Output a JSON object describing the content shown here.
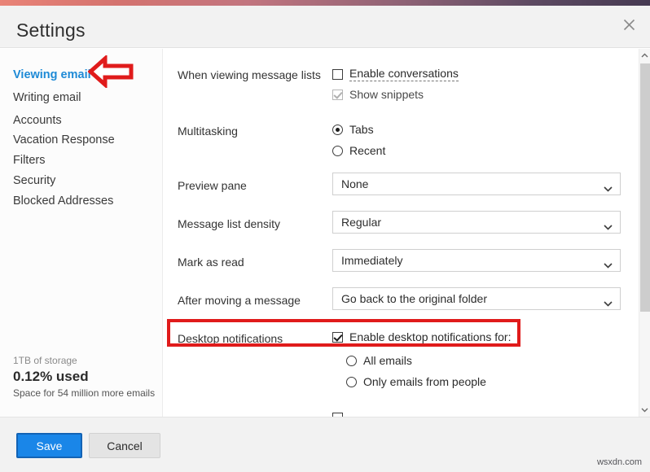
{
  "window": {
    "title": "Settings",
    "close_icon": "close-icon",
    "accent_gradient_start": "#e98377",
    "accent_gradient_end": "#463a52"
  },
  "sidebar": {
    "items": [
      {
        "label": "Viewing email",
        "active": true
      },
      {
        "label": "Writing email",
        "active": false
      },
      {
        "label": "Accounts",
        "active": false
      },
      {
        "label": "Vacation Response",
        "active": false
      },
      {
        "label": "Filters",
        "active": false
      },
      {
        "label": "Security",
        "active": false
      },
      {
        "label": "Blocked Addresses",
        "active": false
      }
    ],
    "active_color": "#1e8ad6",
    "storage": {
      "total": "1TB of storage",
      "used": "0.12% used",
      "note": "Space for 54 million more emails"
    }
  },
  "settings": {
    "rows": [
      {
        "label": "When viewing message lists",
        "options": [
          {
            "type": "checkbox",
            "label": "Enable conversations",
            "checked": false,
            "dotted": true,
            "disabled": false
          },
          {
            "type": "checkbox",
            "label": "Show snippets",
            "checked": true,
            "dotted": false,
            "disabled": true
          }
        ]
      },
      {
        "label": "Multitasking",
        "options": [
          {
            "type": "radio",
            "label": "Tabs",
            "selected": true
          },
          {
            "type": "radio",
            "label": "Recent",
            "selected": false
          }
        ]
      },
      {
        "label": "Preview pane",
        "select_value": "None"
      },
      {
        "label": "Message list density",
        "select_value": "Regular"
      },
      {
        "label": "Mark as read",
        "select_value": "Immediately"
      },
      {
        "label": "After moving a message",
        "select_value": "Go back to the original folder"
      },
      {
        "label": "Desktop notifications",
        "options": [
          {
            "type": "checkbox",
            "label": "Enable desktop notifications for:",
            "checked": true,
            "dotted": false,
            "disabled": false
          },
          {
            "type": "radio",
            "label": "All emails",
            "selected": false
          },
          {
            "type": "radio",
            "label": "Only emails from people",
            "selected": false
          }
        ]
      }
    ]
  },
  "annotations": {
    "highlight_color": "#e01b1b",
    "arrow_color": "#e01b1b",
    "arrow_icon": "arrow-left-icon",
    "highlight_target": "Desktop notifications",
    "arrow_target": "Viewing email"
  },
  "scrollbar": {
    "up_icon": "chevron-up-icon",
    "down_icon": "chevron-down-icon"
  },
  "footer": {
    "save_label": "Save",
    "cancel_label": "Cancel",
    "save_color": "#1a86e8"
  },
  "watermark": "wsxdn.com"
}
